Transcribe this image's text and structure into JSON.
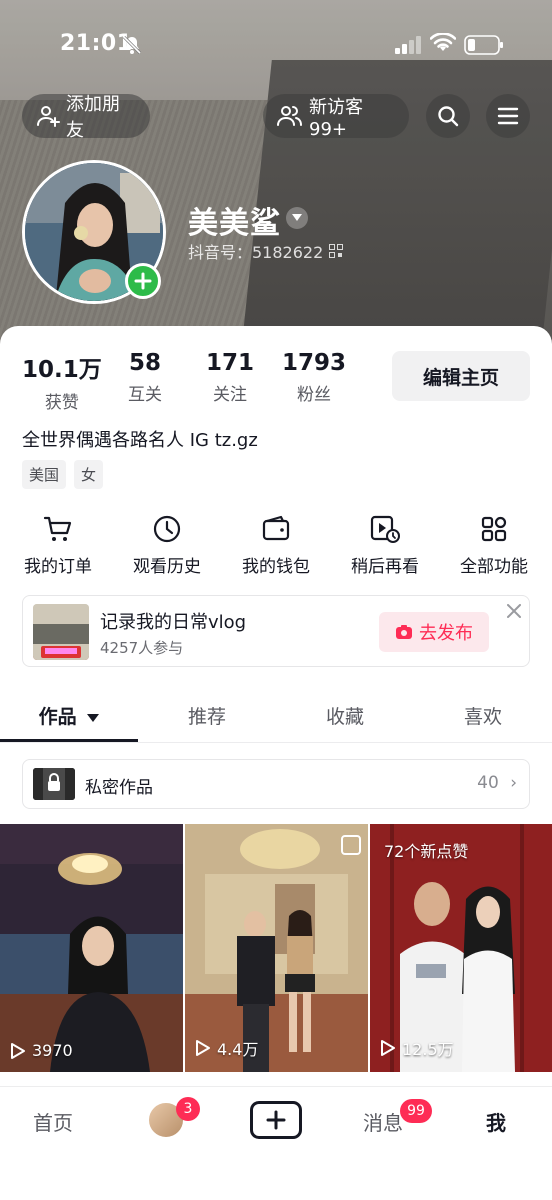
{
  "status_bar": {
    "time": "21:01"
  },
  "header": {
    "add_friend_label": "添加朋友",
    "new_visitors_label": "新访客 99+",
    "username": "美美鲨",
    "douyin_id": "抖音号：5182622"
  },
  "stats": [
    {
      "value": "10.1万",
      "label": "获赞"
    },
    {
      "value": "58",
      "label": "互关"
    },
    {
      "value": "171",
      "label": "关注"
    },
    {
      "value": "1793",
      "label": "粉丝"
    }
  ],
  "edit_profile_label": "编辑主页",
  "bio": "全世界偶遇各路名人 IG tz.gz",
  "tags": [
    "美国",
    "女"
  ],
  "quick_functions": [
    {
      "label": "我的订单",
      "icon": "cart-icon"
    },
    {
      "label": "观看历史",
      "icon": "clock-icon"
    },
    {
      "label": "我的钱包",
      "icon": "wallet-icon"
    },
    {
      "label": "稍后再看",
      "icon": "watch-later-icon"
    },
    {
      "label": "全部功能",
      "icon": "grid-icon"
    }
  ],
  "vlog_banner": {
    "title": "记录我的日常vlog",
    "participants": "4257人参与",
    "publish_label": "去发布"
  },
  "tabs": [
    {
      "label": "作品"
    },
    {
      "label": "推荐"
    },
    {
      "label": "收藏"
    },
    {
      "label": "喜欢"
    }
  ],
  "private_works": {
    "label": "私密作品",
    "count": "40"
  },
  "videos": [
    {
      "plays": "3970"
    },
    {
      "plays": "4.4万"
    },
    {
      "plays": "12.5万",
      "badge": "72个新点赞"
    }
  ],
  "bottom_nav": {
    "home": "首页",
    "friend_badge": "3",
    "messages": "消息",
    "messages_badge": "99",
    "me": "我"
  },
  "colors": {
    "accent": "#fe2c55",
    "add_badge": "#2dbb49",
    "text": "#161823"
  }
}
